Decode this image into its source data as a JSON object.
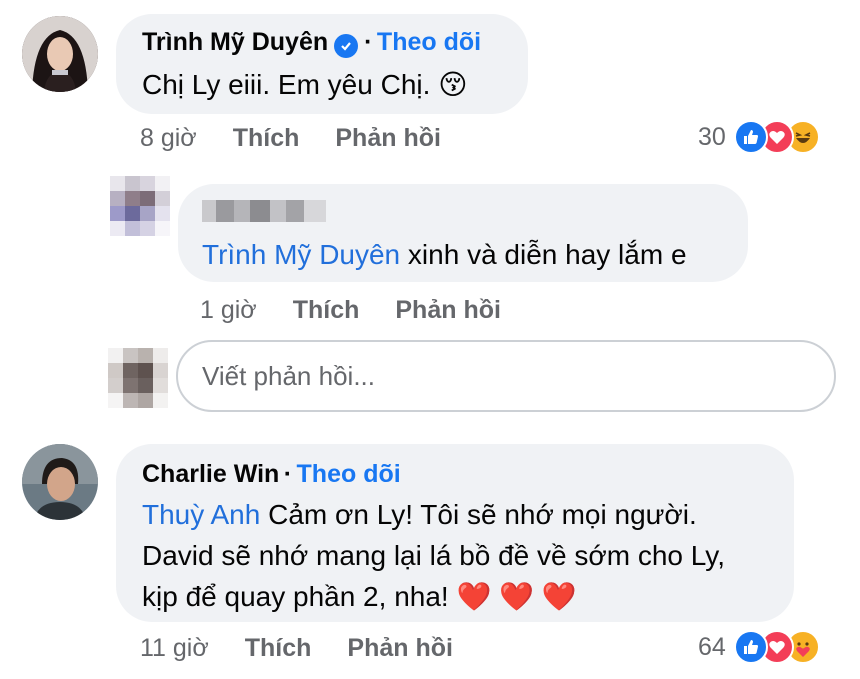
{
  "comments": [
    {
      "author": "Trình Mỹ Duyên",
      "follow_label": "Theo dõi",
      "text": "Chị Ly eiii. Em yêu Chị.",
      "emoji": "😚",
      "time": "8 giờ",
      "like_label": "Thích",
      "reply_label": "Phản hồi",
      "reaction_count": "30",
      "reaction_icons": [
        "like-icon",
        "love-icon",
        "haha-icon"
      ]
    },
    {
      "author_hidden": true,
      "mention": "Trình Mỹ Duyên",
      "text": "xinh và diễn hay lắm e",
      "time": "1 giờ",
      "like_label": "Thích",
      "reply_label": "Phản hồi"
    },
    {
      "author": "Charlie Win",
      "follow_label": "Theo dõi",
      "mention": "Thuỳ Anh",
      "text_line1": "Cảm ơn Ly! Tôi sẽ nhớ mọi người.",
      "text_line2": "David sẽ nhớ mang lại lá bồ đề về sớm cho Ly,",
      "text_line3": "kịp để quay phần 2, nha!",
      "hearts": "❤️ ❤️ ❤️",
      "time": "11 giờ",
      "like_label": "Thích",
      "reply_label": "Phản hồi",
      "reaction_count": "64",
      "reaction_icons": [
        "like-icon",
        "love-icon",
        "care-icon"
      ]
    }
  ],
  "reply_box": {
    "placeholder": "Viết phản hồi..."
  },
  "colors": {
    "bubble": "#f0f2f5",
    "link": "#1877f2",
    "muted": "#65676b",
    "like": "#1877f2",
    "love": "#f33e58",
    "haha": "#f7b125"
  }
}
